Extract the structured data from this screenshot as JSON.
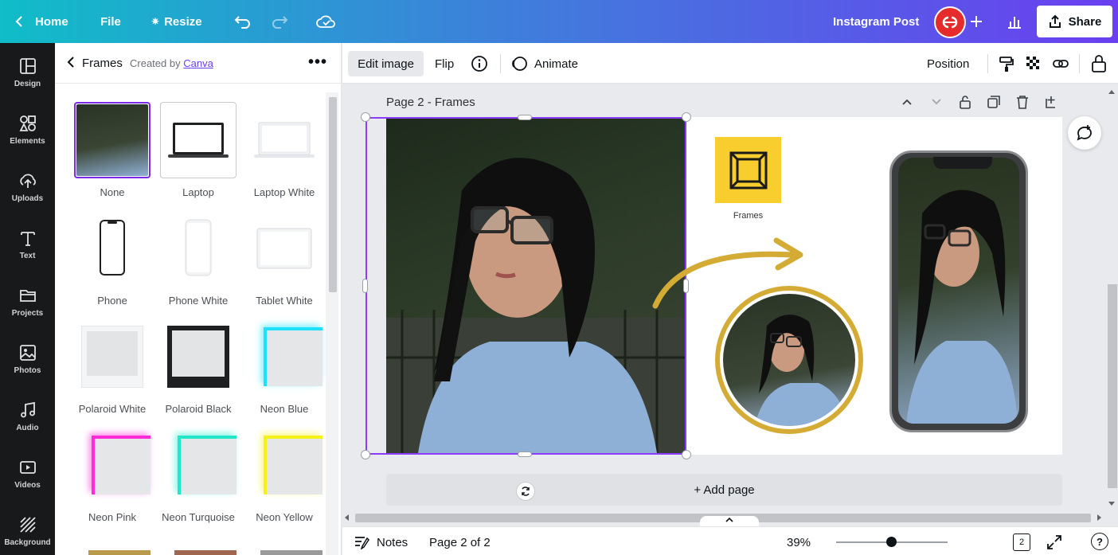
{
  "topbar": {
    "home": "Home",
    "file": "File",
    "resize": "Resize",
    "doc_title": "Instagram Post",
    "share": "Share"
  },
  "rail": [
    {
      "label": "Design",
      "icon": "design-icon"
    },
    {
      "label": "Elements",
      "icon": "elements-icon"
    },
    {
      "label": "Uploads",
      "icon": "uploads-icon"
    },
    {
      "label": "Text",
      "icon": "text-icon"
    },
    {
      "label": "Projects",
      "icon": "folder-icon"
    },
    {
      "label": "Photos",
      "icon": "photos-icon"
    },
    {
      "label": "Audio",
      "icon": "audio-icon"
    },
    {
      "label": "Videos",
      "icon": "videos-icon"
    },
    {
      "label": "Background",
      "icon": "background-icon"
    }
  ],
  "panel": {
    "title": "Frames",
    "created_by": "Created by",
    "creator": "Canva",
    "items": [
      {
        "label": "None"
      },
      {
        "label": "Laptop"
      },
      {
        "label": "Laptop White"
      },
      {
        "label": "Phone"
      },
      {
        "label": "Phone White"
      },
      {
        "label": "Tablet White"
      },
      {
        "label": "Polaroid White"
      },
      {
        "label": "Polaroid Black"
      },
      {
        "label": "Neon Blue"
      },
      {
        "label": "Neon Pink"
      },
      {
        "label": "Neon Turquoise"
      },
      {
        "label": "Neon Yellow"
      }
    ]
  },
  "toolbar": {
    "edit_image": "Edit image",
    "flip": "Flip",
    "animate": "Animate",
    "position": "Position"
  },
  "canvas": {
    "page_label": "Page 2 - Frames",
    "frames_caption": "Frames",
    "add_page": "+ Add page"
  },
  "footer": {
    "notes": "Notes",
    "page_count": "Page 2 of 2",
    "zoom": "39%",
    "pages_badge": "2",
    "help": "?"
  },
  "colors": {
    "accent": "#8b3dff",
    "gold": "#d4ac35",
    "yellow": "#f7ce2e"
  }
}
